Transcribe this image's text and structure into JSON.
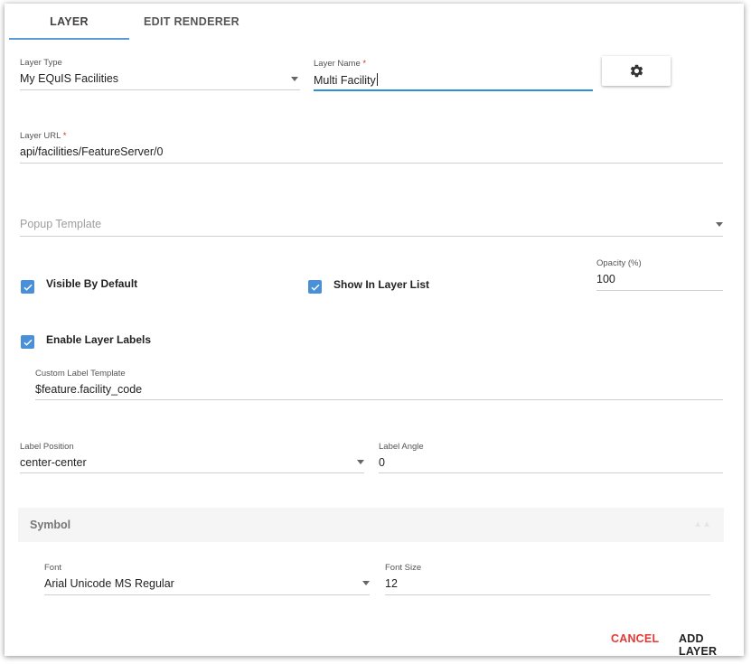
{
  "tabs": [
    {
      "label": "LAYER",
      "active": true
    },
    {
      "label": "EDIT RENDERER",
      "active": false
    }
  ],
  "layer_type": {
    "label": "Layer Type",
    "value": "My EQuIS Facilities"
  },
  "layer_name": {
    "label": "Layer Name",
    "required_mark": "*",
    "value": "Multi Facility"
  },
  "settings_button": {
    "icon": "gear-icon"
  },
  "layer_url": {
    "label": "Layer URL",
    "required_mark": "*",
    "value": "api/facilities/FeatureServer/0"
  },
  "popup_template": {
    "placeholder": "Popup Template"
  },
  "visible_by_default": {
    "label": "Visible By Default",
    "checked": true
  },
  "show_in_layer_list": {
    "label": "Show In Layer List",
    "checked": true
  },
  "opacity": {
    "label": "Opacity (%)",
    "value": "100"
  },
  "enable_layer_labels": {
    "label": "Enable Layer Labels",
    "checked": true
  },
  "custom_label_template": {
    "label": "Custom Label Template",
    "value": "$feature.facility_code"
  },
  "label_position": {
    "label": "Label Position",
    "value": "center-center"
  },
  "label_angle": {
    "label": "Label Angle",
    "value": "0"
  },
  "symbol": {
    "title": "Symbol",
    "font": {
      "label": "Font",
      "value": "Arial Unicode MS Regular"
    },
    "font_size": {
      "label": "Font Size",
      "value": "12"
    }
  },
  "actions": {
    "cancel": "CANCEL",
    "add_layer": "ADD LAYER"
  },
  "colors": {
    "accent": "#2f8fd1",
    "checkbox": "#4a90d9",
    "cancel": "#e53935",
    "required": "#d32f2f"
  }
}
